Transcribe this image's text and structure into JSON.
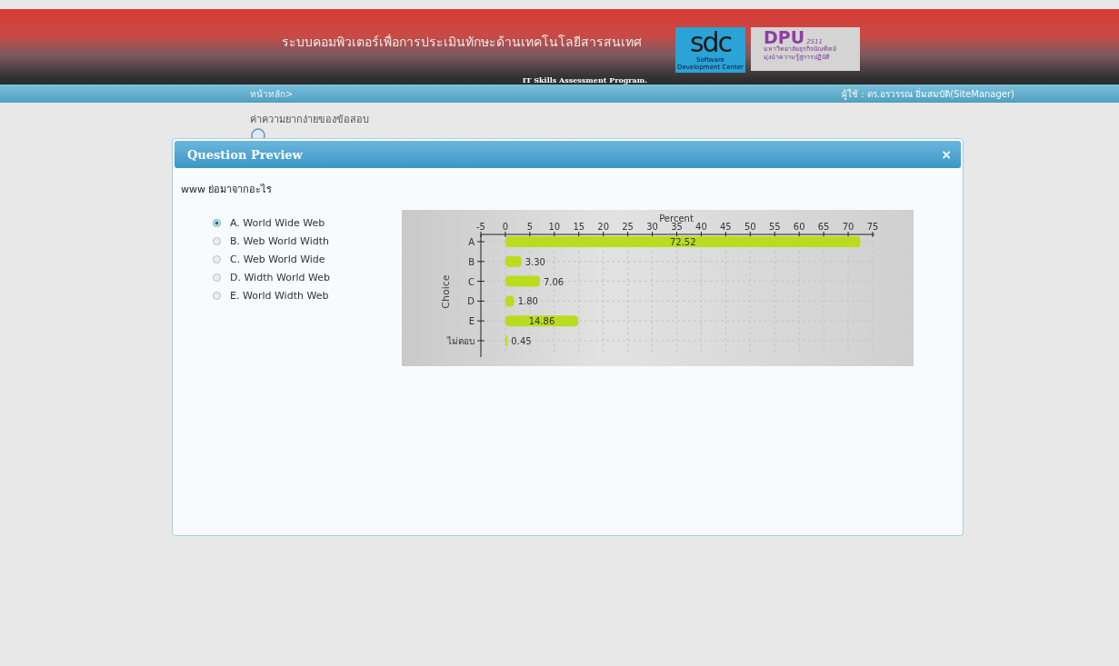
{
  "header": {
    "title": "ระบบคอมพิวเตอร์เพื่อการประเมินทักษะด้านเทคโนโลยีสารสนเทศ",
    "subtitle": "IT Skills Assessment Program.",
    "logo_sdc": {
      "text": "sdc",
      "caption": "Software Development Center"
    },
    "logo_dpu": {
      "text": "DPU",
      "year": "2511",
      "line_1": "มหาวิทยาลัยธุรกิจบัณฑิตย์",
      "line_2": "มุ่งนำความรู้สู่การปฏิบัติ"
    }
  },
  "nav": {
    "breadcrumb": "หน้าหลัก>",
    "user": "ผู้ใช้ : ดร.อรวรรณ อิ่มสมบัติ(SiteManager)"
  },
  "page_heading": "ค่าความยากง่ายของข้อสอบ",
  "dialog": {
    "title": "Question Preview",
    "close": "×",
    "question": "www ย่อมาจากอะไร",
    "options": [
      {
        "label": "A. World Wide Web",
        "selected": true
      },
      {
        "label": "B. Web World Width",
        "selected": false
      },
      {
        "label": "C. Web World Wide",
        "selected": false
      },
      {
        "label": "D. Width World Web",
        "selected": false
      },
      {
        "label": "E. World Width Web",
        "selected": false
      }
    ],
    "chart_data": {
      "type": "bar",
      "orientation": "horizontal",
      "xlabel": "Percent",
      "ylabel": "Choice",
      "categories": [
        "A",
        "B",
        "C",
        "D",
        "E",
        "ไม่ตอบ"
      ],
      "values": [
        72.52,
        3.3,
        7.06,
        1.8,
        14.86,
        0.45
      ],
      "value_labels": [
        "72.52",
        "3.30",
        "7.06",
        "1.80",
        "14.86",
        "0.45"
      ],
      "xlim": [
        -5,
        75
      ],
      "xticks": [
        -5,
        0,
        5,
        10,
        15,
        20,
        25,
        30,
        35,
        40,
        45,
        50,
        55,
        60,
        65,
        70,
        75
      ],
      "grid": true
    }
  }
}
